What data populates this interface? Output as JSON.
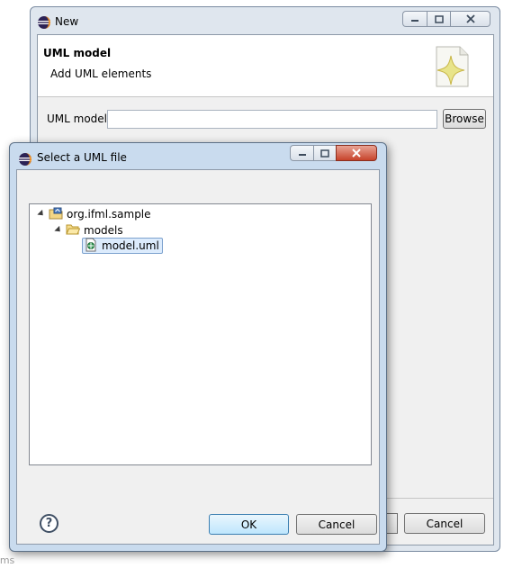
{
  "background_window": {
    "title": "New",
    "banner_title": "UML model",
    "banner_description": "Add UML elements",
    "uml_model_label": "UML model",
    "uml_model_value": "",
    "browse_label": "Browse",
    "cancel_label": "Cancel"
  },
  "dialog": {
    "title": "Select a UML file",
    "tree": [
      {
        "label": "org.ifml.sample",
        "icon": "project-icon",
        "expanded": true,
        "depth": 0
      },
      {
        "label": "models",
        "icon": "folder-icon",
        "expanded": true,
        "depth": 1
      },
      {
        "label": "model.uml",
        "icon": "uml-file-icon",
        "selected": true,
        "depth": 2
      }
    ],
    "ok_label": "OK",
    "cancel_label": "Cancel",
    "help_symbol": "?"
  },
  "partial_text": "lems",
  "colors": {
    "window_frame": "#dfe6ee",
    "dialog_frame": "#c9dbee",
    "selection": "#dcebfc",
    "default_button": "#bee6fd"
  }
}
